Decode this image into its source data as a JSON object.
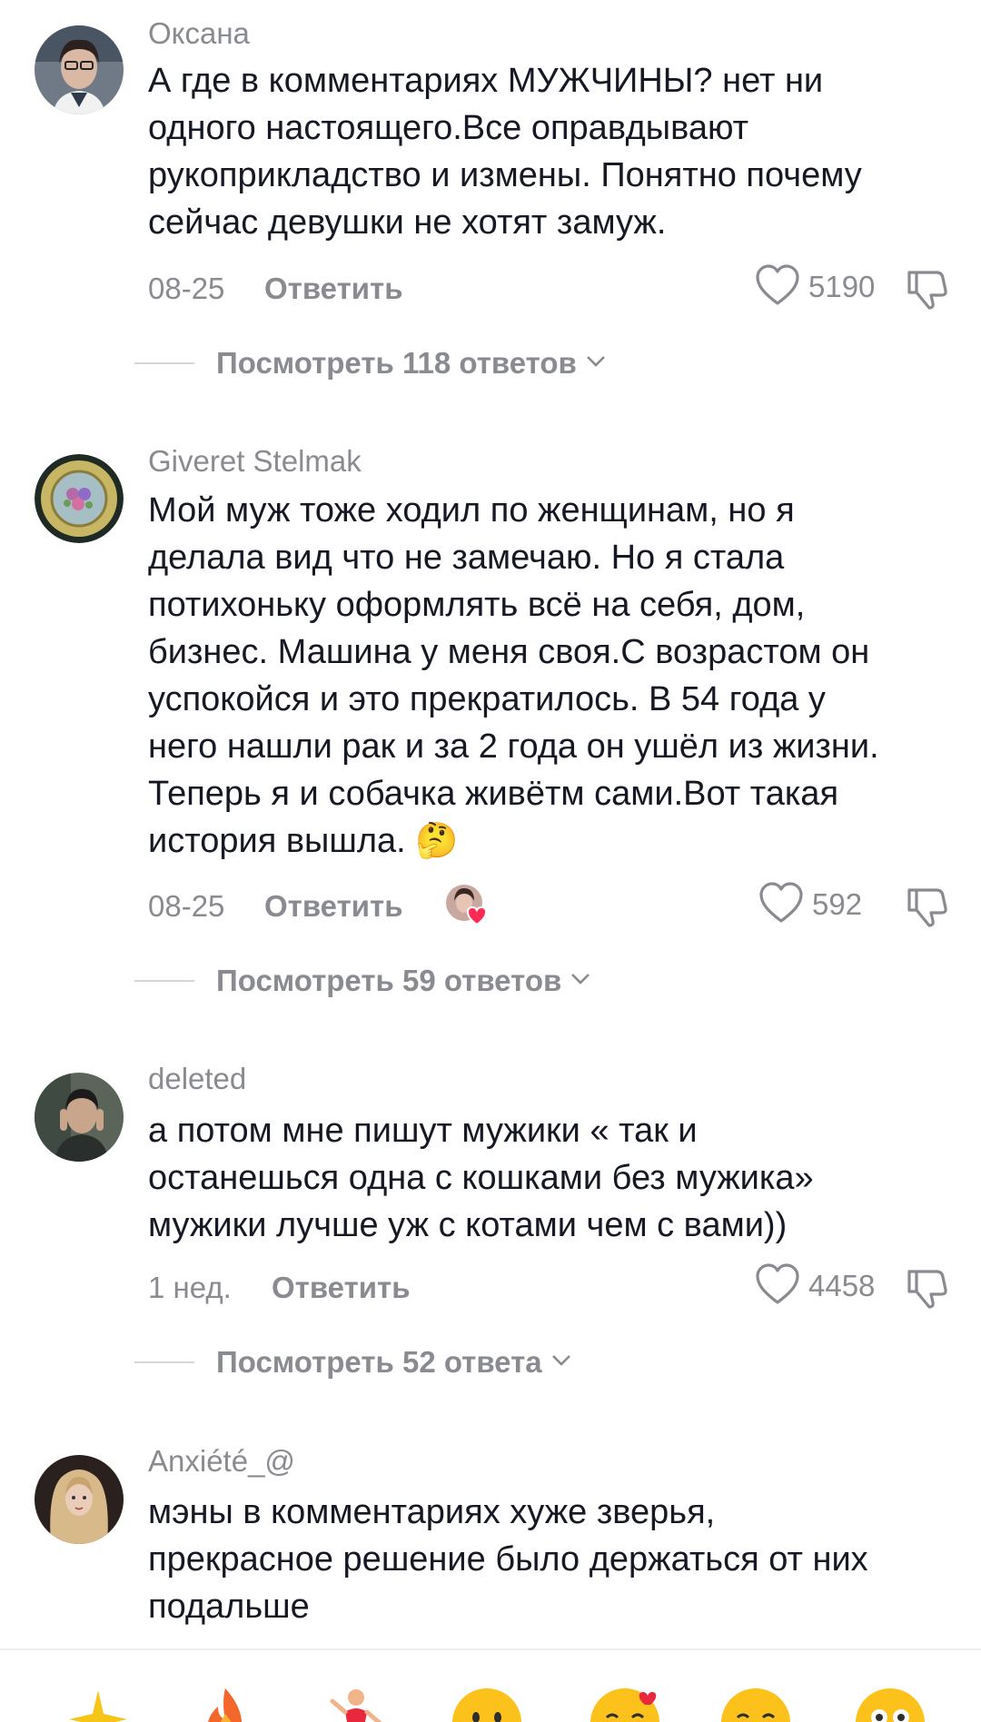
{
  "comments": [
    {
      "username": "Оксана",
      "text_lines": [
        "А где в комментариях МУЖЧИНЫ? нет ни",
        "одного настоящего.Все оправдывают",
        "рукоприкладство и измены. Понятно почему",
        "сейчас девушки не хотят замуж."
      ],
      "date": "08-25",
      "reply_label": "Ответить",
      "likes": "5190",
      "view_replies": "Посмотреть 118 ответов"
    },
    {
      "username": "Giveret Stelmak",
      "text_lines": [
        "Мой муж тоже ходил по женщинам, но я",
        "делала вид что не замечаю. Но я стала",
        "потихоньку оформлять всё на себя, дом,",
        "бизнес. Машина у меня своя.С возрастом он",
        "успокойся и это прекратилось. В 54 года у",
        "него нашли рак и за 2 года он ушёл из жизни.",
        "Теперь я и собачка живётм сами.Вот такая",
        "история вышла. 🤔"
      ],
      "date": "08-25",
      "reply_label": "Ответить",
      "likes": "592",
      "view_replies": "Посмотреть 59 ответов"
    },
    {
      "username": "deleted",
      "text_lines": [
        "а потом мне пишут мужики « так и",
        "останешься одна с кошками без мужика»",
        "мужики лучше уж с котами чем с вами))"
      ],
      "date": "1 нед.",
      "reply_label": "Ответить",
      "likes": "4458",
      "view_replies": "Посмотреть 52 ответа"
    },
    {
      "username": "Anxiété_@",
      "text_lines": [
        "мэны в комментариях хуже зверья,",
        "прекрасное решение было держаться от них",
        "подальше"
      ]
    }
  ],
  "icons": {
    "like": "heart-outline-icon",
    "dislike": "thumbs-down-icon",
    "expand": "chevron-down-icon"
  },
  "emoji_bar": [
    "sparkles",
    "fire",
    "dancer",
    "grinning",
    "hearts-face",
    "smiling",
    "flushed"
  ],
  "colors": {
    "text": "#161823",
    "secondary": "#8a8b91",
    "divider": "#d6d7da",
    "like_red": "#fe2c55"
  }
}
